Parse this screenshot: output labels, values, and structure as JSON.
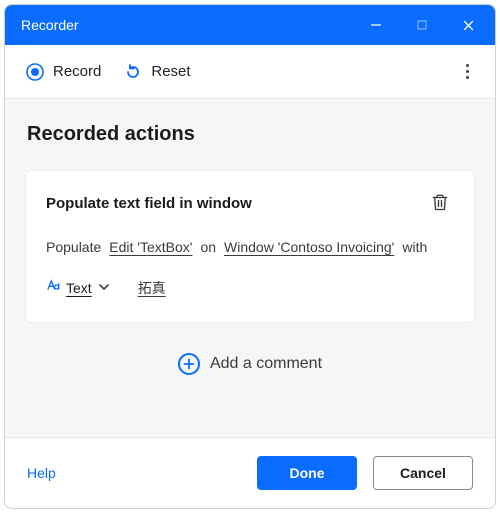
{
  "window": {
    "title": "Recorder"
  },
  "toolbar": {
    "record_label": "Record",
    "reset_label": "Reset"
  },
  "section": {
    "title": "Recorded actions"
  },
  "action_card": {
    "title": "Populate text field in window",
    "parts": {
      "verb": "Populate",
      "target": "Edit 'TextBox'",
      "on": "on",
      "window": "Window 'Contoso Invoicing'",
      "with": "with",
      "type_label": "Text",
      "value": "拓真"
    }
  },
  "add_comment_label": "Add a comment",
  "footer": {
    "help_label": "Help",
    "done_label": "Done",
    "cancel_label": "Cancel"
  },
  "colors": {
    "accent": "#0a6cff"
  }
}
